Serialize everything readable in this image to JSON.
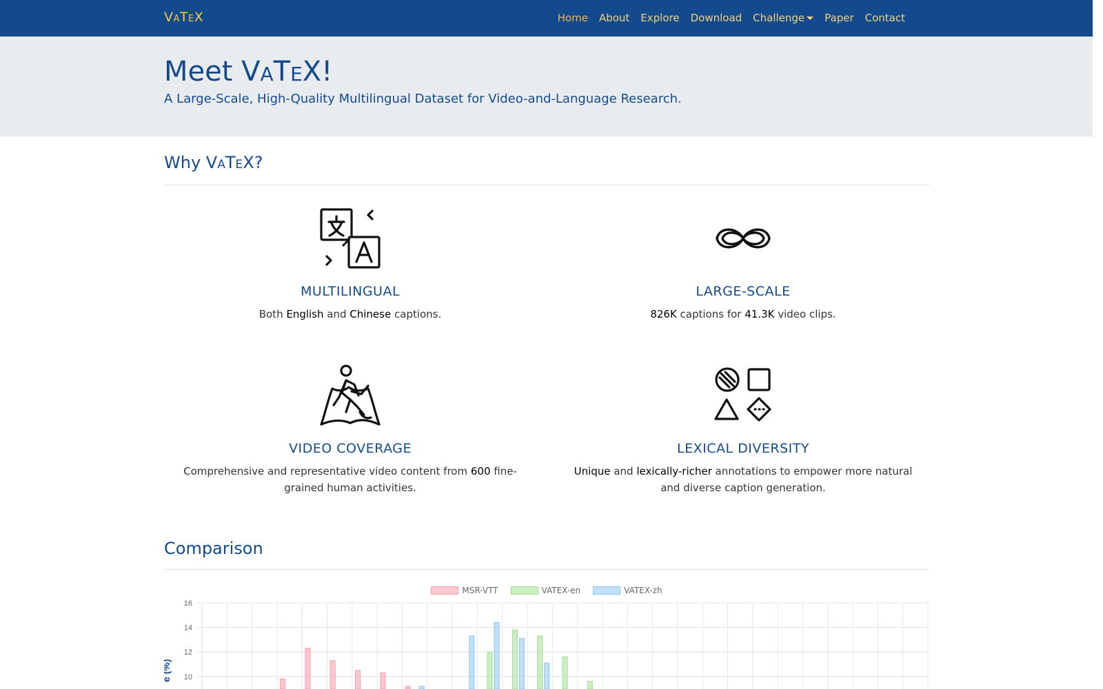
{
  "navbar": {
    "brand": "VATEX",
    "links": [
      {
        "label": "Home",
        "active": true
      },
      {
        "label": "About"
      },
      {
        "label": "Explore"
      },
      {
        "label": "Download"
      },
      {
        "label": "Challenge",
        "dropdown": true
      },
      {
        "label": "Paper"
      },
      {
        "label": "Contact"
      }
    ]
  },
  "jumbotron": {
    "title": "Meet VATEX!",
    "subtitle": "A Large-Scale, High-Quality Multilingual Dataset for Video-and-Language Research."
  },
  "why": {
    "heading": "Why VATEX?",
    "features": [
      {
        "icon": "translate-icon",
        "title": "MULTILINGUAL",
        "desc_parts": [
          [
            "Both ",
            false
          ],
          [
            "English",
            true
          ],
          [
            " and ",
            false
          ],
          [
            "Chinese",
            true
          ],
          [
            " captions.",
            false
          ]
        ]
      },
      {
        "icon": "infinity-icon",
        "title": "LARGE-SCALE",
        "desc_parts": [
          [
            "826K",
            true
          ],
          [
            " captions for ",
            false
          ],
          [
            "41.3K",
            true
          ],
          [
            " video clips.",
            false
          ]
        ]
      },
      {
        "icon": "map-explorer-icon",
        "title": "VIDEO COVERAGE",
        "desc_parts": [
          [
            "Comprehensive and representative video content from ",
            false
          ],
          [
            "600",
            true
          ],
          [
            " fine-grained human activities.",
            false
          ]
        ]
      },
      {
        "icon": "shapes-icon",
        "title": "LEXICAL DIVERSITY",
        "desc_parts": [
          [
            "Unique",
            true
          ],
          [
            " and ",
            false
          ],
          [
            "lexically-richer",
            true
          ],
          [
            " annotations to empower more natural and diverse caption generation.",
            false
          ]
        ]
      }
    ]
  },
  "comparison": {
    "heading": "Comparison"
  },
  "chart_data": {
    "type": "bar",
    "ylabel": "e (%)",
    "ylim_visible": [
      10,
      16
    ],
    "yticks": [
      16,
      14,
      12,
      10
    ],
    "colors": {
      "MSR-VTT": "#ff9aa8",
      "VATEX-en": "#9fdf8f",
      "VATEX-zh": "#8fc5f5"
    },
    "category_count": 29,
    "series": [
      {
        "name": "MSR-VTT",
        "values": {
          "3": 9.8,
          "4": 12.3,
          "5": 11.3,
          "6": 10.5,
          "7": 10.3,
          "8": 9.2
        }
      },
      {
        "name": "VATEX-en",
        "values": {
          "11": 12.0,
          "12": 13.8,
          "13": 13.3,
          "14": 11.6,
          "15": 9.6
        }
      },
      {
        "name": "VATEX-zh",
        "values": {
          "8": 9.2,
          "10": 13.3,
          "11": 14.4,
          "12": 13.1,
          "13": 11.1
        }
      }
    ]
  }
}
